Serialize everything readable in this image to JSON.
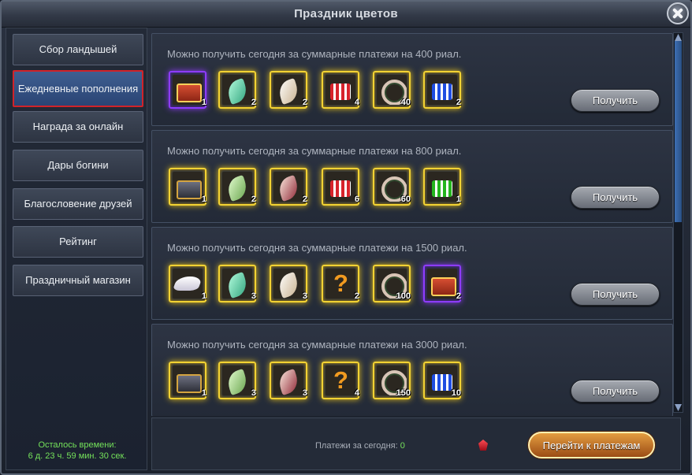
{
  "window": {
    "title": "Праздник цветов"
  },
  "sidebar": {
    "items": [
      {
        "label": "Сбор ландышей"
      },
      {
        "label": "Ежедневные пополнения"
      },
      {
        "label": "Награда за онлайн"
      },
      {
        "label": "Дары богини"
      },
      {
        "label": "Благословение друзей"
      },
      {
        "label": "Рейтинг"
      },
      {
        "label": "Праздничный магазин"
      }
    ],
    "selected": "Ежедневные пополнения",
    "timer": {
      "label": "Осталось времени:",
      "value": "6 д. 23 ч. 59 мин. 30 сек."
    }
  },
  "rows": [
    {
      "text": "Можно получить сегодня за суммарные платежи на 400 риал.",
      "button": "Получить",
      "items": [
        {
          "icon": "chest-icon",
          "count": "1"
        },
        {
          "icon": "teal-feather-icon",
          "count": "2"
        },
        {
          "icon": "white-feather-icon",
          "count": "2"
        },
        {
          "icon": "red-gift-icon",
          "count": "4"
        },
        {
          "icon": "flower-wreath-icon",
          "count": "40"
        },
        {
          "icon": "blue-gift-icon",
          "count": "2"
        }
      ]
    },
    {
      "text": "Можно получить сегодня за суммарные платежи на 800 риал.",
      "button": "Получить",
      "items": [
        {
          "icon": "chest-icon",
          "count": "1"
        },
        {
          "icon": "green-feather-icon",
          "count": "2"
        },
        {
          "icon": "red-feather-icon",
          "count": "2"
        },
        {
          "icon": "red-gift-icon",
          "count": "6"
        },
        {
          "icon": "flower-wreath-icon",
          "count": "60"
        },
        {
          "icon": "green-gift-icon",
          "count": "1"
        }
      ]
    },
    {
      "text": "Можно получить сегодня за суммарные платежи на 1500 риал.",
      "button": "Получить",
      "items": [
        {
          "icon": "wings-icon",
          "count": "1"
        },
        {
          "icon": "teal-feather-icon",
          "count": "3"
        },
        {
          "icon": "white-feather-icon",
          "count": "3"
        },
        {
          "icon": "question-mark-icon",
          "count": "2"
        },
        {
          "icon": "flower-wreath-icon",
          "count": "100"
        },
        {
          "icon": "chest-icon",
          "count": "2"
        }
      ]
    },
    {
      "text": "Можно получить сегодня за суммарные платежи на 3000 риал.",
      "button": "Получить",
      "items": [
        {
          "icon": "dark-chest-icon",
          "count": "1"
        },
        {
          "icon": "green-feather-icon",
          "count": "3"
        },
        {
          "icon": "red-feather-icon",
          "count": "3"
        },
        {
          "icon": "question-mark-icon",
          "count": "4"
        },
        {
          "icon": "flower-wreath-icon",
          "count": "150"
        },
        {
          "icon": "blue-gift-icon",
          "count": "10"
        }
      ]
    }
  ],
  "footer": {
    "payments_label": "Платежи за сегодня:",
    "payments_value": "0",
    "goto_button": "Перейти к платежам"
  }
}
